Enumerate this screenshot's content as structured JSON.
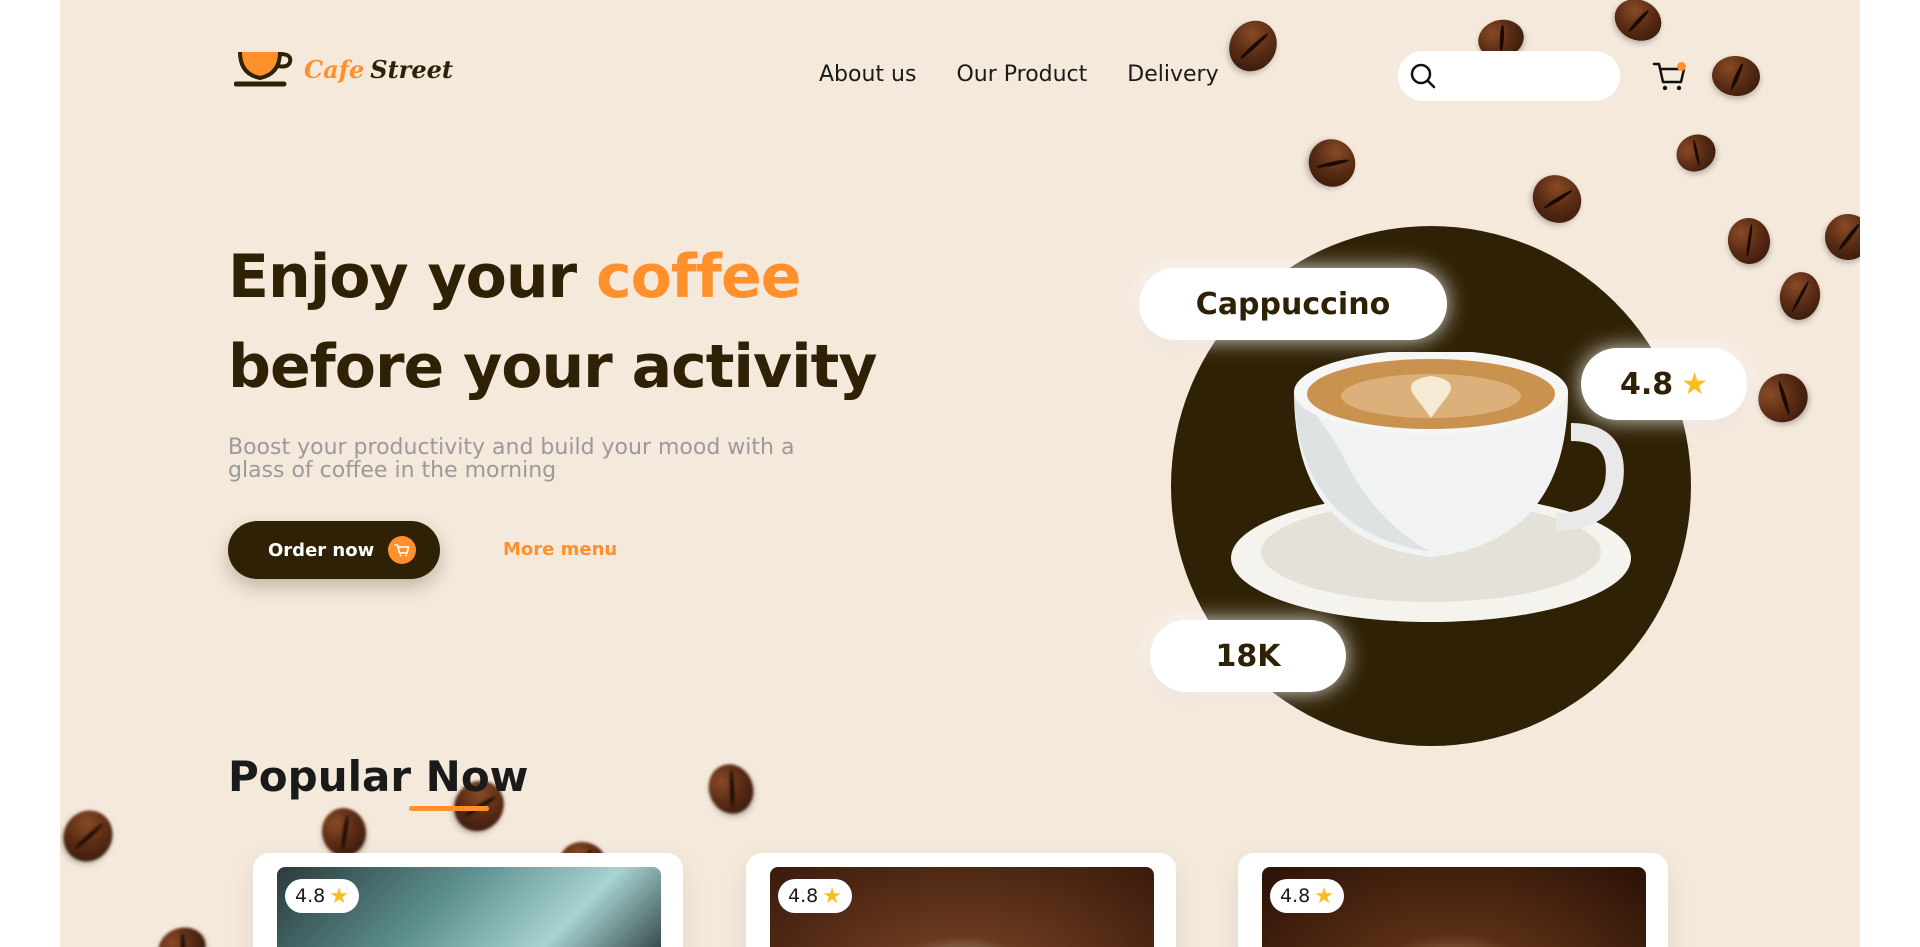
{
  "brand": {
    "name_part1": "Cafe",
    "name_part2": "Street"
  },
  "nav": {
    "items": [
      "About us",
      "Our Product",
      "Delivery"
    ]
  },
  "search": {
    "placeholder": ""
  },
  "hero": {
    "title_line1_prefix": "Enjoy your ",
    "title_line1_accent": "coffee",
    "title_line2": "before your activity",
    "subtitle": "Boost your productivity and build your mood with a glass of coffee in the morning",
    "order_button": "Order now",
    "more_menu": "More menu"
  },
  "featured": {
    "name": "Cappuccino",
    "rating": "4.8",
    "count": "18K"
  },
  "popular": {
    "title": "Popular Now"
  },
  "cards": [
    {
      "rating": "4.8"
    },
    {
      "rating": "4.8"
    },
    {
      "rating": "4.8"
    }
  ],
  "colors": {
    "brown": "#2f2105",
    "orange": "#ff902b",
    "cream": "#f5e9dc",
    "star": "#fbbe21"
  },
  "icons": {
    "search": "search-icon",
    "cart": "cart-icon",
    "star": "star-icon"
  }
}
